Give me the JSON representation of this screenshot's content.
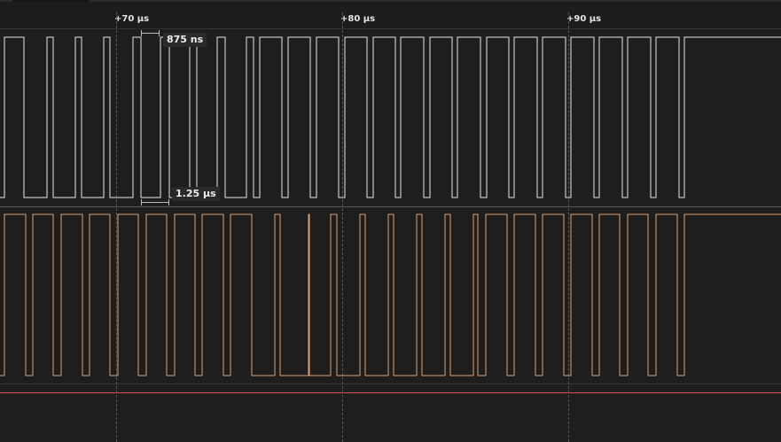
{
  "timeline": {
    "markers": [
      {
        "label": "+70 µs"
      },
      {
        "label": "+80 µs"
      },
      {
        "label": "+90 µs"
      }
    ]
  },
  "measurements": {
    "width": {
      "label": "875 ns"
    },
    "period": {
      "label": "1.25 µs"
    }
  },
  "channels": [
    {
      "id": "ch0",
      "color": "#e8e8e8"
    },
    {
      "id": "ch1",
      "color": "#e0a070"
    },
    {
      "id": "ch2",
      "color": "#e05050"
    }
  ]
}
